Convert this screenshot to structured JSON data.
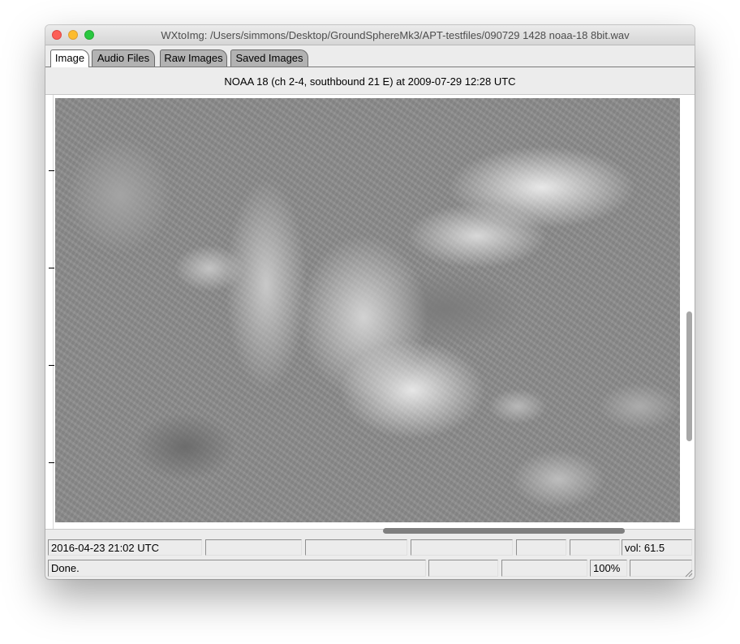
{
  "window": {
    "title": "WXtoImg: /Users/simmons/Desktop/GroundSphereMk3/APT-testfiles/090729 1428 noaa-18 8bit.wav"
  },
  "tabs": [
    {
      "label": "Image",
      "active": true
    },
    {
      "label": "Audio Files",
      "active": false
    },
    {
      "label": "Raw Images",
      "active": false
    },
    {
      "label": "Saved Images",
      "active": false
    }
  ],
  "image": {
    "caption": "NOAA 18 (ch 2-4, southbound 21 E) at 2009-07-29  12:28 UTC",
    "description_icon": "satellite-image"
  },
  "statusbar": {
    "row1": {
      "datetime": "2016-04-23  21:02 UTC",
      "field2": "",
      "field3": "",
      "field4": "",
      "field5": "",
      "field6": "",
      "volume": "vol: 61.5"
    },
    "row2": {
      "message": "Done.",
      "field2": "",
      "field3": "",
      "zoom": "100%",
      "field5": ""
    }
  },
  "colors": {
    "close": "#fc5f57",
    "minimize": "#fdbc2e",
    "zoom": "#29c840",
    "tab_inactive": "#b2b2b2",
    "tab_active": "#ffffff"
  }
}
